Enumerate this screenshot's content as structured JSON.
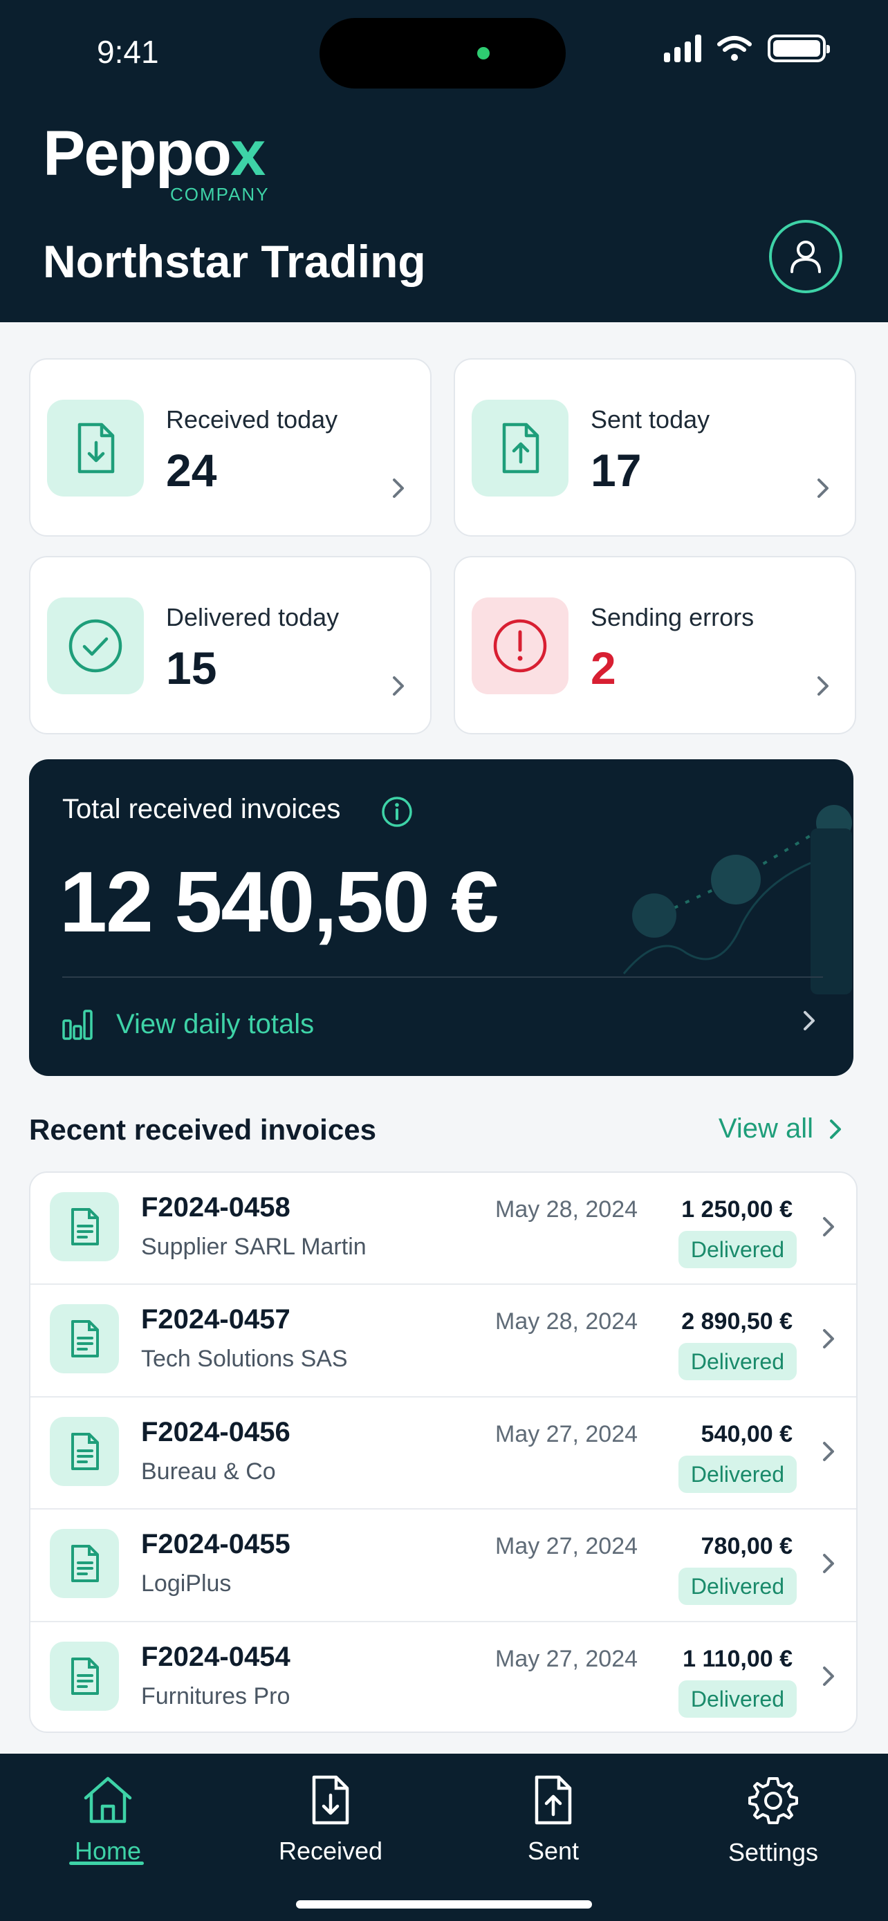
{
  "status_bar": {
    "time": "9:41"
  },
  "header": {
    "logo_main": "Peppo",
    "logo_accent": "x",
    "logo_sub": "COMPANY",
    "company_name": "Northstar Trading"
  },
  "stats": [
    {
      "label": "Received today",
      "value": "24",
      "icon": "document-download-icon"
    },
    {
      "label": "Sent today",
      "value": "17",
      "icon": "document-upload-icon"
    },
    {
      "label": "Delivered today",
      "value": "15",
      "icon": "check-circle-icon"
    },
    {
      "label": "Sending errors",
      "value": "2",
      "icon": "alert-circle-icon"
    }
  ],
  "total_card": {
    "label": "Total received invoices",
    "amount": "12 540,50 €",
    "link": "View daily totals"
  },
  "recent": {
    "title": "Recent received invoices",
    "view_all": "View all",
    "invoices": [
      {
        "number": "F2024-0458",
        "supplier": "Supplier SARL Martin",
        "date": "May 28, 2024",
        "amount": "1 250,00 €",
        "status": "Delivered"
      },
      {
        "number": "F2024-0457",
        "supplier": "Tech Solutions SAS",
        "date": "May 28, 2024",
        "amount": "2 890,50 €",
        "status": "Delivered"
      },
      {
        "number": "F2024-0456",
        "supplier": "Bureau & Co",
        "date": "May 27, 2024",
        "amount": "540,00 €",
        "status": "Delivered"
      },
      {
        "number": "F2024-0455",
        "supplier": "LogiPlus",
        "date": "May 27, 2024",
        "amount": "780,00 €",
        "status": "Delivered"
      },
      {
        "number": "F2024-0454",
        "supplier": "Furnitures Pro",
        "date": "May 27, 2024",
        "amount": "1 110,00 €",
        "status": "Delivered"
      }
    ]
  },
  "tabs": [
    {
      "label": "Home",
      "icon": "home-icon",
      "active": true
    },
    {
      "label": "Received",
      "icon": "document-download-icon",
      "active": false
    },
    {
      "label": "Sent",
      "icon": "document-upload-icon",
      "active": false
    },
    {
      "label": "Settings",
      "icon": "gear-icon",
      "active": false
    }
  ],
  "colors": {
    "navy": "#0b1f2e",
    "accent": "#3ed3a7",
    "error": "#d81f32",
    "badge_bg": "#d6f4ea"
  }
}
